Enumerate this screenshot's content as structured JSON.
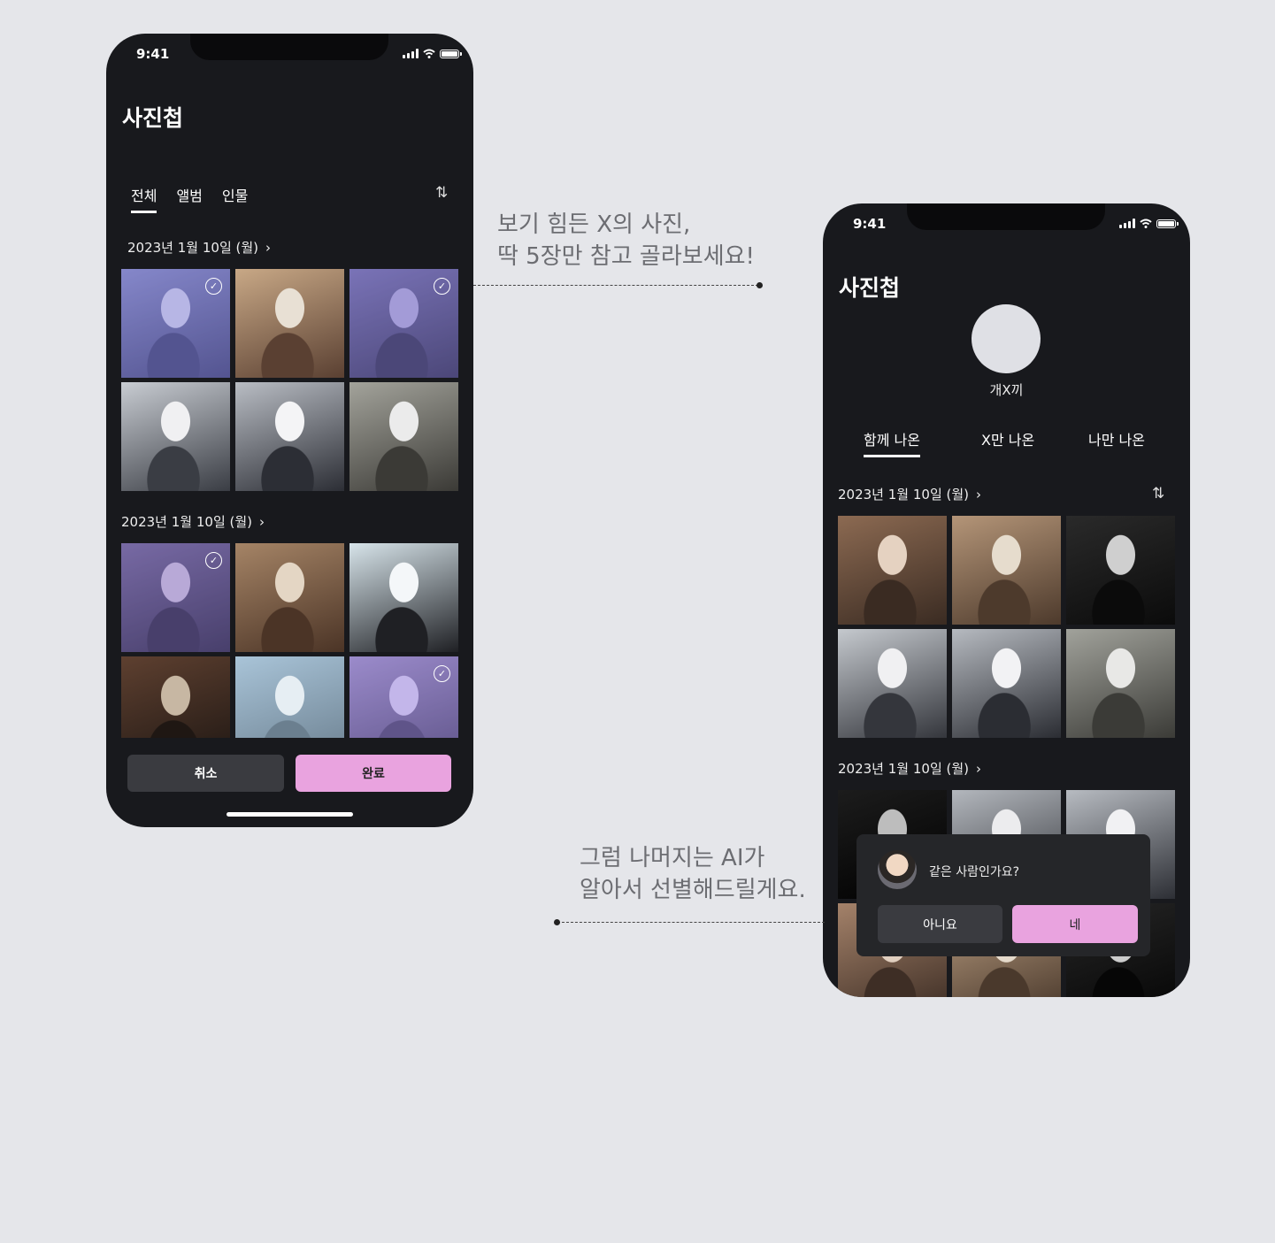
{
  "status_time": "9:41",
  "screen1": {
    "title": "사진첩",
    "tabs": [
      "전체",
      "앨범",
      "인물"
    ],
    "section1_date": "2023년 1월 10일 (월)",
    "section2_date": "2023년 1월 10일 (월)",
    "section1_photos": [
      {
        "selected": true,
        "colors": [
          "#7f86b6",
          "#3a3f66",
          "#c4c6dc"
        ]
      },
      {
        "selected": false,
        "colors": [
          "#c8a886",
          "#5a4032",
          "#e8e0d4"
        ]
      },
      {
        "selected": true,
        "colors": [
          "#6f6a9c",
          "#2f2d45",
          "#a8a1c8"
        ]
      },
      {
        "selected": false,
        "colors": [
          "#c8ccd2",
          "#3a3d44",
          "#f0f0f2"
        ]
      },
      {
        "selected": false,
        "colors": [
          "#b9bdc4",
          "#2c2e35",
          "#f4f4f6"
        ]
      },
      {
        "selected": false,
        "colors": [
          "#a3a39b",
          "#3b3a36",
          "#ebebeb"
        ]
      }
    ],
    "section2_photos": [
      {
        "selected": true,
        "colors": [
          "#6c5d82",
          "#2a2233",
          "#c5b4c8"
        ]
      },
      {
        "selected": false,
        "colors": [
          "#a58466",
          "#4b3426",
          "#e4d6c4"
        ]
      },
      {
        "selected": false,
        "colors": [
          "#d7e4ea",
          "#1f2024",
          "#f4f7f9"
        ]
      },
      {
        "selected": false,
        "colors": [
          "#5e4030",
          "#1f1713",
          "#c7b7a3"
        ]
      },
      {
        "selected": false,
        "colors": [
          "#a9c4d8",
          "#6b7f8f",
          "#e6eef3"
        ]
      },
      {
        "selected": true,
        "colors": [
          "#9d8bb7",
          "#4a3f5c",
          "#d4c7e2"
        ]
      }
    ],
    "cancel_label": "취소",
    "done_label": "완료"
  },
  "screen2": {
    "title": "사진첩",
    "person_name": "개X끼",
    "tabs": [
      "함께 나온",
      "X만 나온",
      "나만 나온"
    ],
    "section1_date": "2023년 1월 10일 (월)",
    "section2_date": "2023년 1월 10일 (월)",
    "section1_photos": [
      {
        "colors": [
          "#8c6a52",
          "#3a2b22",
          "#e5d2c1"
        ]
      },
      {
        "colors": [
          "#b49578",
          "#4d3a2c",
          "#e6dccd"
        ]
      },
      {
        "colors": [
          "#2a2a2a",
          "#0b0b0b",
          "#cfcfcf"
        ]
      },
      {
        "colors": [
          "#c5c9ce",
          "#34363c",
          "#f0f0f2"
        ]
      },
      {
        "colors": [
          "#b6bac0",
          "#2b2d33",
          "#f2f2f4"
        ]
      },
      {
        "colors": [
          "#a1a29b",
          "#3b3b37",
          "#e8e8e6"
        ]
      }
    ],
    "section2_photos": [
      {
        "colors": [
          "#1c1c1c",
          "#000000",
          "#bdbdbd"
        ]
      },
      {
        "colors": [
          "#b3b7bd",
          "#34363b",
          "#ececee"
        ]
      },
      {
        "colors": [
          "#b7bbc1",
          "#2d2f35",
          "#f1f1f3"
        ]
      },
      {
        "colors": [
          "#a4826a",
          "#3e2e25",
          "#e1cfbf"
        ]
      },
      {
        "colors": [
          "#b89c80",
          "#4a392c",
          "#e5dacb"
        ]
      },
      {
        "colors": [
          "#262626",
          "#060606",
          "#cccccc"
        ]
      }
    ],
    "dialog": {
      "question": "같은 사람인가요?",
      "no_label": "아니요",
      "yes_label": "네"
    }
  },
  "captions": {
    "top_line1": "보기 힘든 X의 사진,",
    "top_line2": "딱 5장만 참고 골라보세요!",
    "bottom_line1": "그럼 나머지는 AI가",
    "bottom_line2": "알아서 선별해드릴게요."
  },
  "icons": {
    "sort": "sort-arrows-icon",
    "chevron": "chevron-right-icon",
    "check": "check-circle-icon"
  },
  "colors": {
    "background": "#e5e6ea",
    "phone": "#18191d",
    "accent_pink": "#e9a3df",
    "button_gray": "#3a3b40"
  }
}
